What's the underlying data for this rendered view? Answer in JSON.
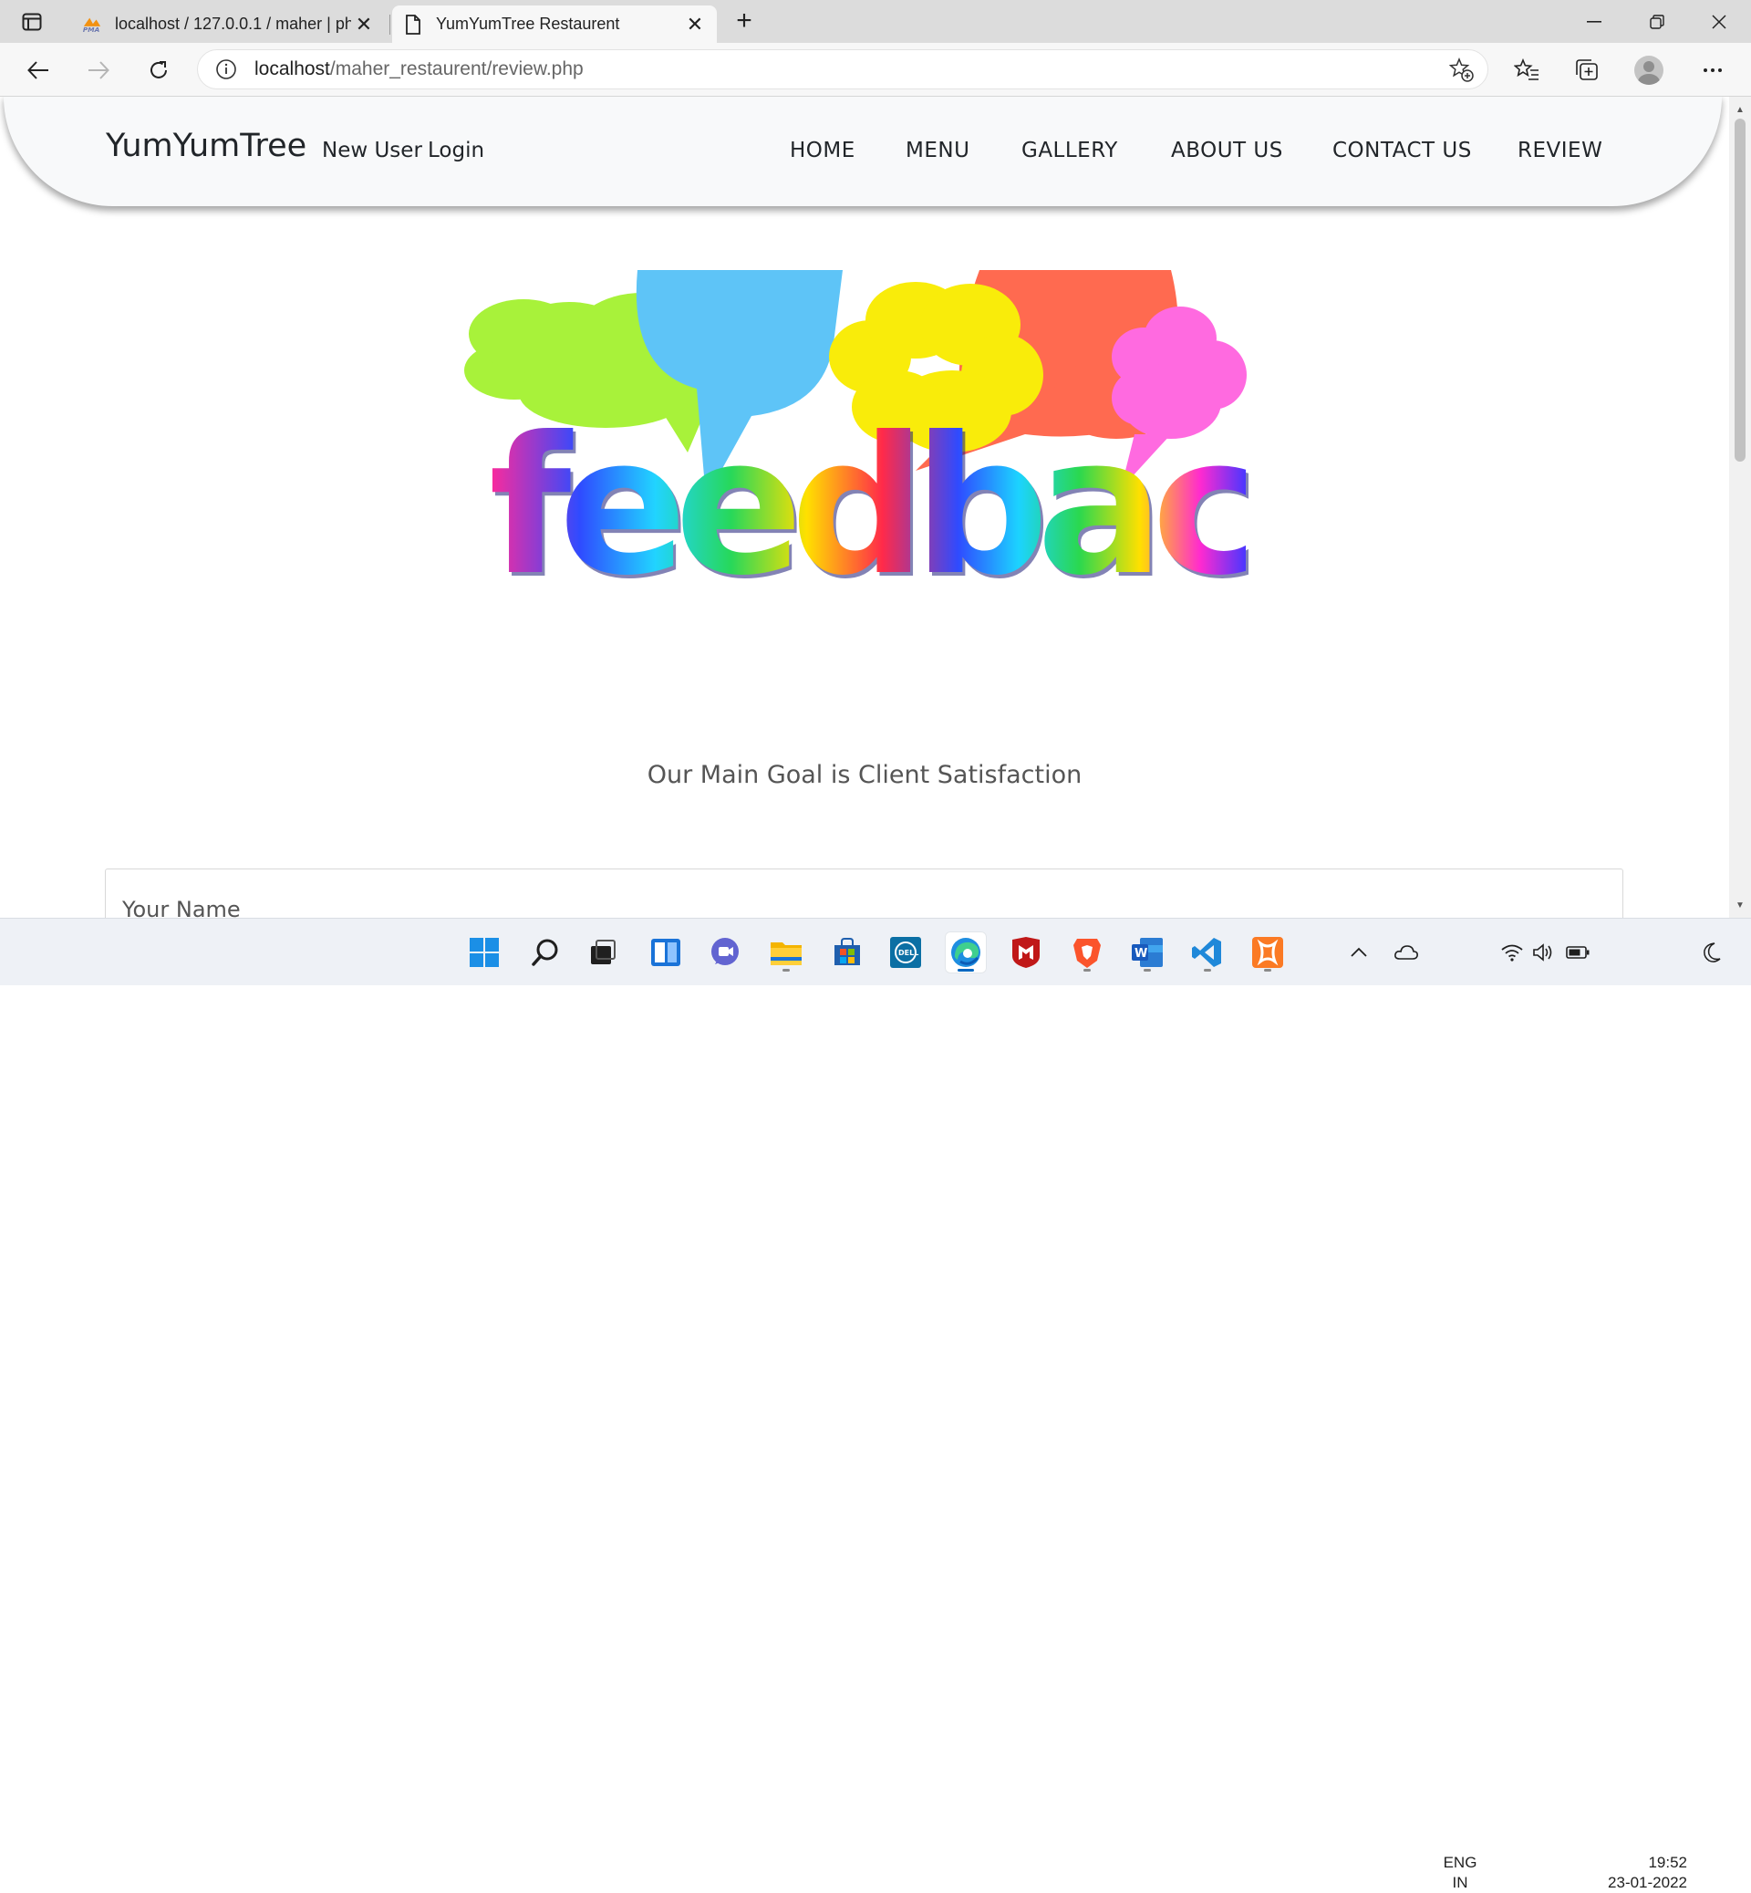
{
  "browser": {
    "tabs": [
      {
        "title": "localhost / 127.0.0.1 / maher | ph",
        "favicon": "phpmyadmin-icon",
        "active": false
      },
      {
        "title": "YumYumTree Restaurent",
        "favicon": "page-icon",
        "active": true
      }
    ],
    "url_host": "localhost",
    "url_path": "/maher_restaurent/review.php"
  },
  "site": {
    "brand": "YumYumTree",
    "auth_links": [
      "New User",
      "Login"
    ],
    "menu": [
      "HOME",
      "MENU",
      "GALLERY",
      "ABOUT US",
      "CONTACT US",
      "REVIEW"
    ],
    "hero_word": "feedback",
    "tagline": "Our Main Goal is Client Satisfaction",
    "name_placeholder": "Your Name"
  },
  "taskbar": {
    "apps": [
      "start-icon",
      "search-icon",
      "task-view-icon",
      "widgets-icon",
      "teams-chat-icon",
      "file-explorer-icon",
      "microsoft-store-icon",
      "dell-icon",
      "edge-icon",
      "mcafee-icon",
      "brave-icon",
      "word-icon",
      "vscode-icon",
      "xampp-icon"
    ],
    "lang_top": "ENG",
    "lang_bottom": "IN",
    "time": "19:52",
    "date": "23-01-2022"
  },
  "colors": {
    "accent": "#0067c0",
    "nav_bg": "#f8f9fa",
    "cloud_green": "#a8f23a",
    "cloud_blue": "#5ec4f7",
    "cloud_yellow": "#f9ec0a",
    "cloud_red": "#ff6a50",
    "cloud_pink": "#ff6ae0"
  }
}
